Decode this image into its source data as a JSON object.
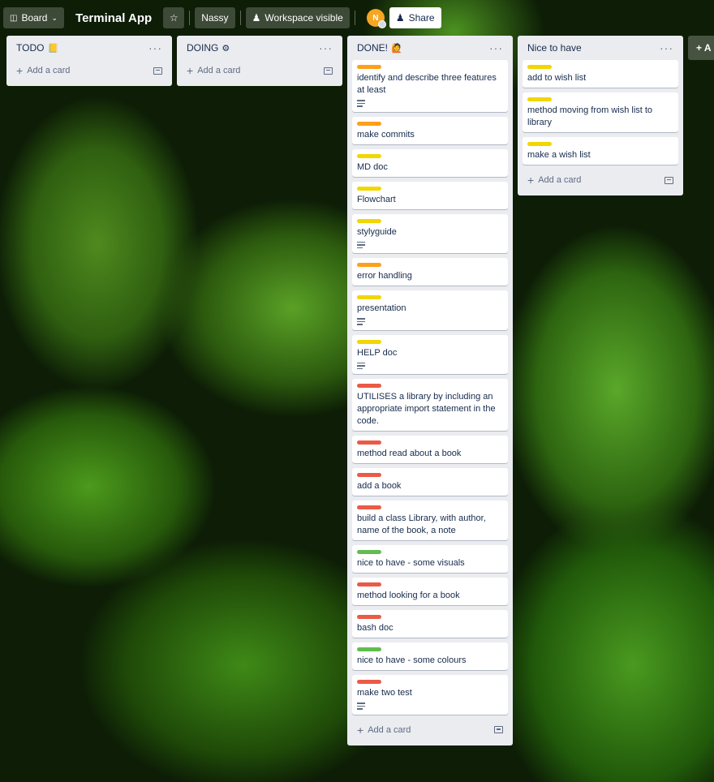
{
  "topbar": {
    "board_label": "Board",
    "board_title": "Terminal App",
    "workspace_name": "Nassy",
    "visibility_label": "Workspace visible",
    "avatar_initial": "N",
    "share_label": "Share"
  },
  "colors": {
    "orange": "#ff9f1a",
    "yellow": "#f2d600",
    "red": "#eb5a46",
    "green": "#61bd4f"
  },
  "lists": [
    {
      "title": "TODO",
      "title_icon": "notebook-emoji",
      "add_card_label": "Add a card",
      "cards": []
    },
    {
      "title": "DOING",
      "title_icon": "gear-emoji",
      "add_card_label": "Add a card",
      "cards": []
    },
    {
      "title": "DONE!",
      "title_icon": "person-emoji",
      "add_card_label": "Add a card",
      "cards": [
        {
          "label": "orange",
          "text": "identify and describe three features at least",
          "has_description": true
        },
        {
          "label": "orange",
          "text": "make commits",
          "has_description": false
        },
        {
          "label": "yellow",
          "text": "MD doc",
          "has_description": false
        },
        {
          "label": "yellow",
          "text": "Flowchart",
          "has_description": false
        },
        {
          "label": "yellow",
          "text": "stylyguide",
          "has_description": true
        },
        {
          "label": "orange",
          "text": "error handling",
          "has_description": false
        },
        {
          "label": "yellow",
          "text": "presentation",
          "has_description": true
        },
        {
          "label": "yellow",
          "text": "HELP doc",
          "has_description": true
        },
        {
          "label": "red",
          "text": "UTILISES a library by including an appropriate import statement in the code.",
          "has_description": false
        },
        {
          "label": "red",
          "text": "method read about a book",
          "has_description": false
        },
        {
          "label": "red",
          "text": "add a book",
          "has_description": false
        },
        {
          "label": "red",
          "text": "build a class Library, with author, name of the book, a note",
          "has_description": false
        },
        {
          "label": "green",
          "text": "nice to have - some visuals",
          "has_description": false
        },
        {
          "label": "red",
          "text": "method looking for a book",
          "has_description": false
        },
        {
          "label": "red",
          "text": "bash doc",
          "has_description": false
        },
        {
          "label": "green",
          "text": "nice to have - some colours",
          "has_description": false
        },
        {
          "label": "red",
          "text": "make two test",
          "has_description": true
        }
      ]
    },
    {
      "title": "Nice to have",
      "title_icon": "",
      "add_card_label": "Add a card",
      "cards": [
        {
          "label": "yellow",
          "text": "add to wish list",
          "has_description": false
        },
        {
          "label": "yellow",
          "text": "method moving from wish list to library",
          "has_description": false
        },
        {
          "label": "yellow",
          "text": "make a wish list",
          "has_description": false
        }
      ]
    }
  ],
  "add_list_label": "+ A"
}
